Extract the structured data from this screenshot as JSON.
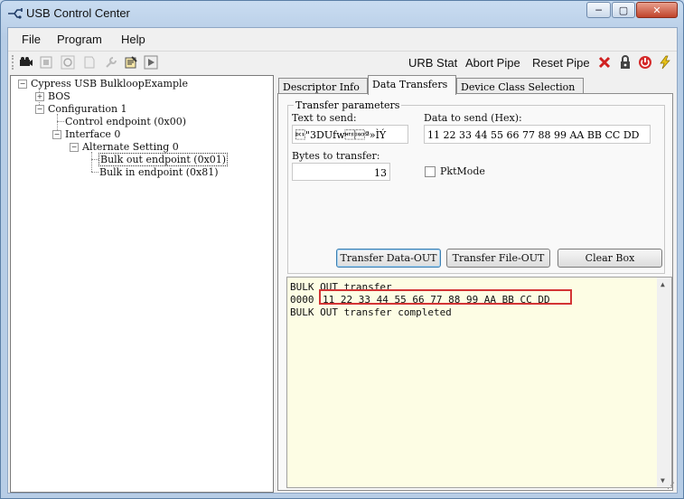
{
  "window": {
    "title": "USB Control Center",
    "controls": {
      "minimize": "─",
      "maximize": "▢",
      "close": "✕"
    }
  },
  "menu": [
    "File",
    "Program",
    "Help"
  ],
  "toolbar": {
    "icons": [
      "camera-icon",
      "stop-icon",
      "refresh-icon",
      "page-icon",
      "wrench-icon",
      "notepad-icon",
      "play-icon"
    ],
    "actions": [
      "URB Stat",
      "Abort Pipe",
      "Reset Pipe"
    ]
  },
  "tree": {
    "root": "Cypress USB BulkloopExample",
    "bos": "BOS",
    "config": "Configuration 1",
    "control_ep": "Control endpoint (0x00)",
    "interface": "Interface 0",
    "alt": "Alternate Setting 0",
    "bulk_out": "Bulk out endpoint (0x01)",
    "bulk_in": "Bulk in endpoint (0x81)"
  },
  "tabs": [
    "Descriptor Info",
    "Data Transfers",
    "Device Class Selection"
  ],
  "transfer": {
    "group_label": "Transfer parameters",
    "text_label": "Text to send:",
    "text_value": "\u0011\"3DUfwª»ÌÝ",
    "hex_label": "Data to send (Hex):",
    "hex_value": "11 22 33 44 55 66 77 88 99 AA BB CC DD",
    "bytes_label": "Bytes to transfer:",
    "bytes_value": "13",
    "pktmode_label": "PktMode",
    "buttons": [
      "Transfer Data-OUT",
      "Transfer File-OUT",
      "Clear Box"
    ]
  },
  "output": {
    "line1": "BULK OUT transfer",
    "line2_addr": "0000",
    "line2_data": "11 22 33 44 55 66 77 88 99 AA BB CC DD",
    "line3": "BULK OUT transfer completed"
  },
  "colors": {
    "highlight": "#d33434",
    "output_bg": "#fdfde4"
  }
}
